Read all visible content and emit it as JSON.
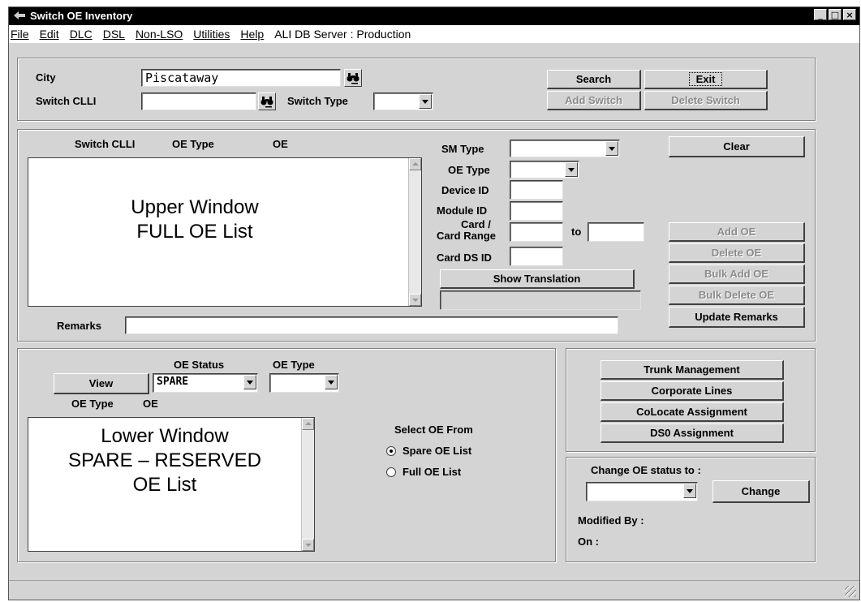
{
  "window": {
    "title": "Switch OE Inventory",
    "buttons": [
      "_",
      "□",
      "×"
    ]
  },
  "menu": [
    "File",
    "Edit",
    "DLC",
    "DSL",
    "Non-LSO",
    "Utilities",
    "Help"
  ],
  "menu_extra": "ALI DB Server : Production",
  "top": {
    "city_label": "City",
    "city_value": "Piscataway",
    "switch_clli_label": "Switch CLLI",
    "switch_clli_value": "",
    "switch_type_label": "Switch Type",
    "search": "Search",
    "exit": "Exit",
    "add_switch": "Add Switch",
    "delete_switch": "Delete Switch"
  },
  "upper": {
    "col_switch_clli": "Switch CLLI",
    "col_oe_type": "OE Type",
    "col_oe": "OE",
    "list_line1": "Upper Window",
    "list_line2": "FULL OE List",
    "sm_type": "SM Type",
    "oe_type": "OE Type",
    "device_id": "Device ID",
    "module_id": "Module ID",
    "card_range_1": "Card /",
    "card_range_2": "Card Range",
    "to": "to",
    "card_ds_id": "Card DS ID",
    "show_translation": "Show Translation",
    "remarks": "Remarks",
    "clear": "Clear",
    "add_oe": "Add OE",
    "delete_oe": "Delete OE",
    "bulk_add_oe": "Bulk Add OE",
    "bulk_delete_oe": "Bulk Delete OE",
    "update_remarks": "Update Remarks"
  },
  "lower": {
    "view": "View",
    "oe_status_label": "OE Status",
    "oe_status_value": "SPARE",
    "oe_type_label": "OE Type",
    "col_oe_type": "OE Type",
    "col_oe": "OE",
    "list_line1": "Lower Window",
    "list_line2": "SPARE – RESERVED",
    "list_line3": "OE List",
    "select_from": "Select OE From",
    "spare_list": "Spare OE List",
    "full_list": "Full OE List"
  },
  "right": {
    "trunk": "Trunk Management",
    "corporate": "Corporate Lines",
    "colocate": "CoLocate Assignment",
    "ds0": "DS0 Assignment",
    "change_status_label": "Change OE status to :",
    "change": "Change",
    "modified_by": "Modified By :",
    "on": "On :"
  }
}
